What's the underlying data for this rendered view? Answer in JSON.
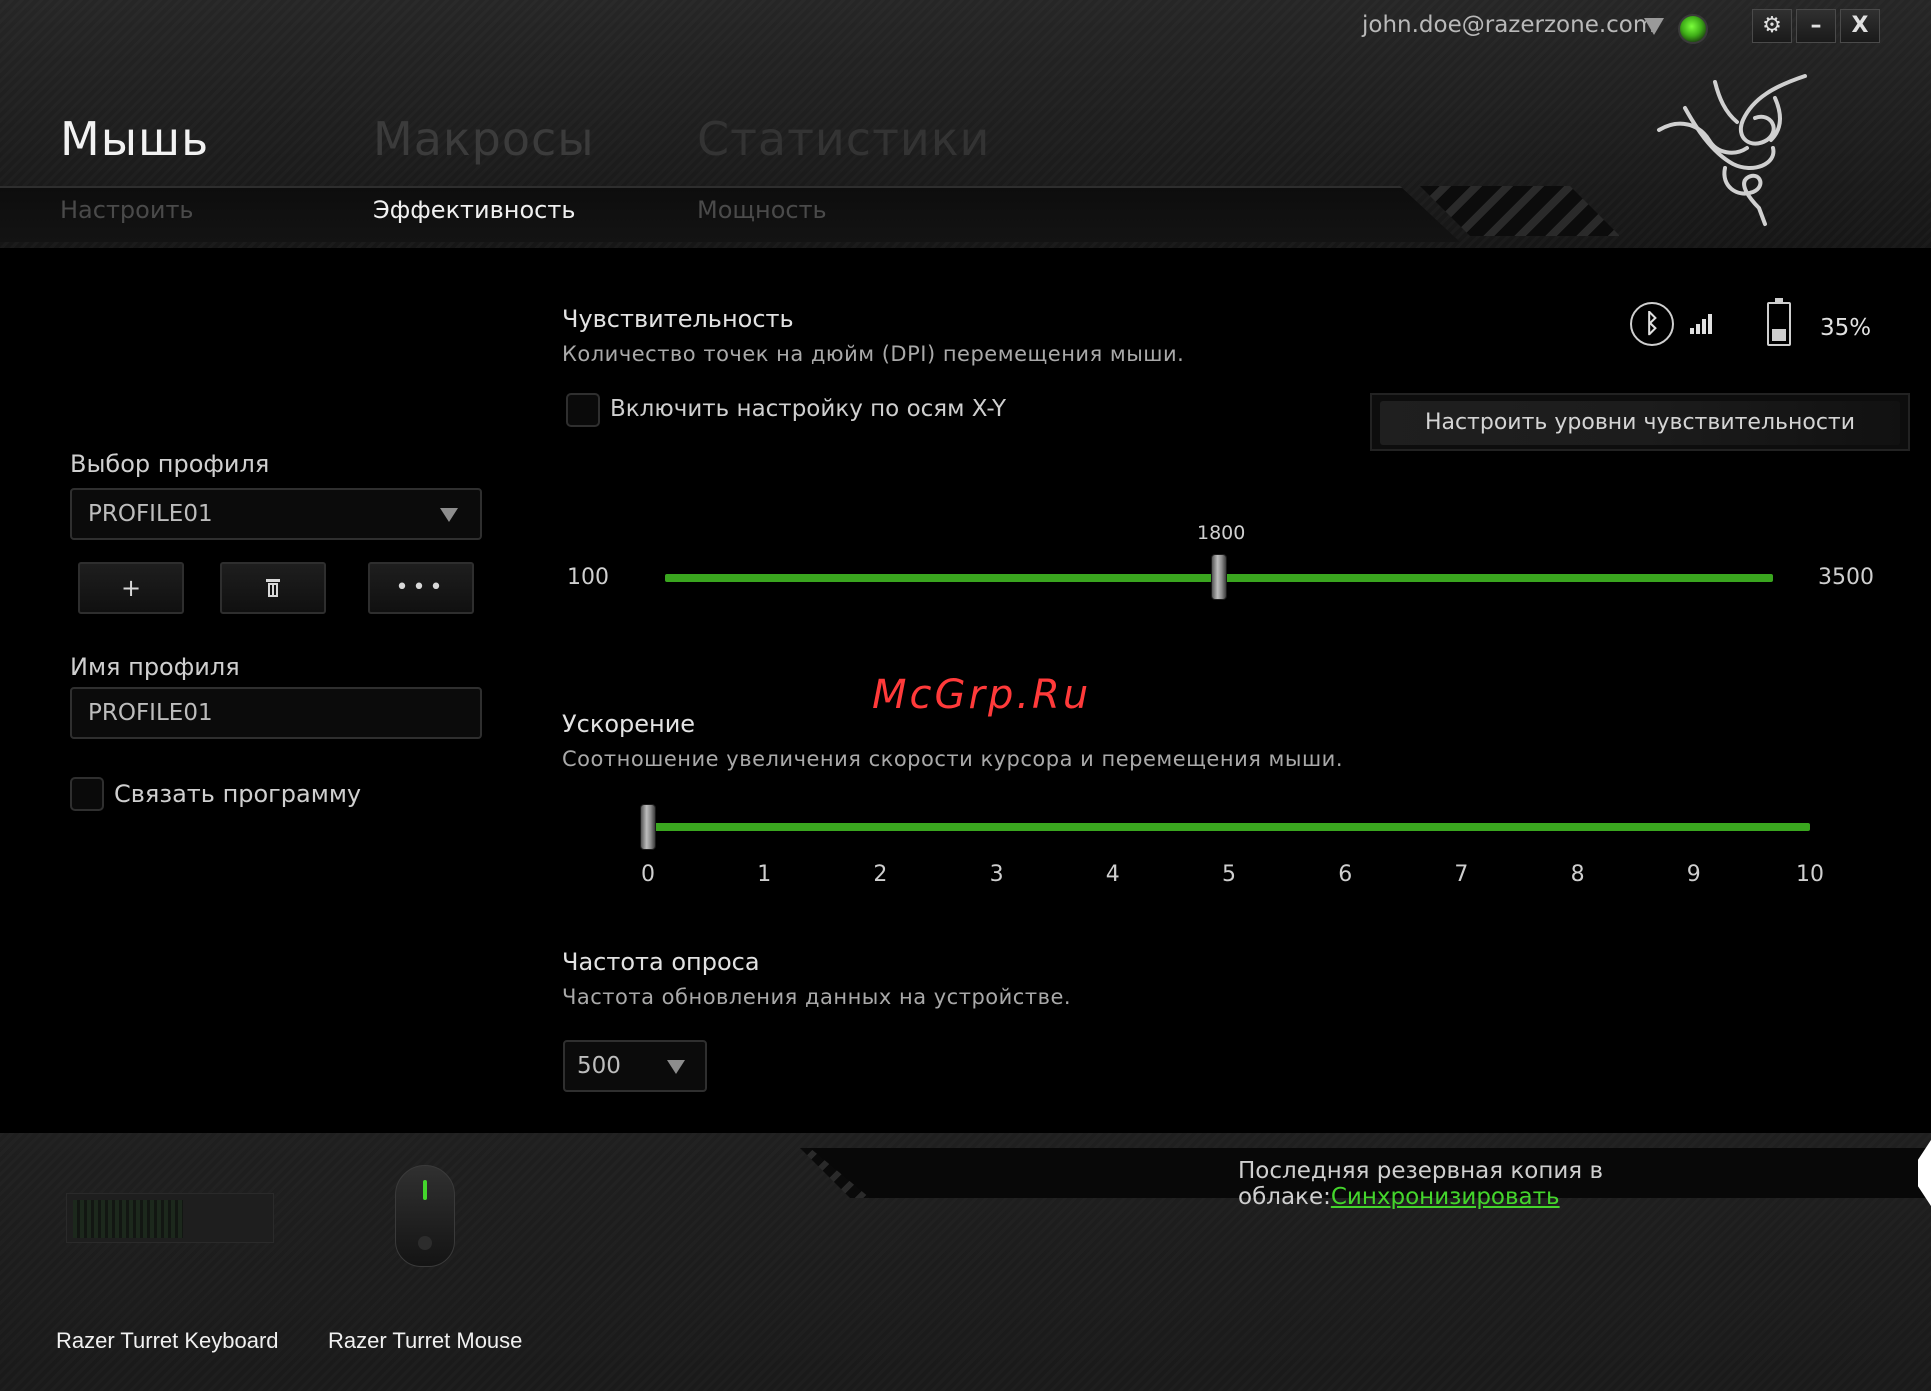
{
  "header": {
    "user_email": "john.doe@razerzone.com",
    "window_buttons": {
      "settings": "⚙",
      "minimize": "–",
      "close": "X"
    },
    "main_tabs": [
      "Мышь",
      "Макросы",
      "Статистики"
    ],
    "sub_tabs": [
      "Настроить",
      "Эффективность",
      "Мощность"
    ],
    "active_main_tab": "Мышь",
    "active_sub_tab": "Эффективность"
  },
  "profile": {
    "select_label": "Выбор профиля",
    "selected": "PROFILE01",
    "buttons": {
      "add": "+",
      "delete": "🗑",
      "more": "•••"
    },
    "name_label": "Имя профиля",
    "name_value": "PROFILE01",
    "link_program_label": "Связать программу",
    "link_program_checked": false
  },
  "status": {
    "bluetooth": "bluetooth-icon",
    "signal": "signal-icon",
    "battery_percent": "35%",
    "battery_level": 0.35
  },
  "sensitivity": {
    "title": "Чувствительность",
    "description": "Количество точек на дюйм (DPI) перемещения мыши.",
    "xy_label": "Включить настройку по осям X-Y",
    "xy_checked": false,
    "stages_button": "Настроить уровни чувствительности",
    "min": "100",
    "max": "3500",
    "value": "1800",
    "value_num": 1800,
    "min_num": 100,
    "max_num": 3500
  },
  "acceleration": {
    "title": "Ускорение",
    "description": "Соотношение увеличения скорости курсора и перемещения мыши.",
    "value": 0,
    "ticks": [
      "0",
      "1",
      "2",
      "3",
      "4",
      "5",
      "6",
      "7",
      "8",
      "9",
      "10"
    ]
  },
  "polling": {
    "title": "Частота опроса",
    "description": "Частота обновления данных на устройстве.",
    "value": "500"
  },
  "watermark": "McGrp.Ru",
  "footer": {
    "backup_text": "Последняя резервная копия в облаке:",
    "sync_link": "Синхронизировать",
    "devices": [
      "Razer Turret Keyboard",
      "Razer Turret Mouse"
    ]
  },
  "colors": {
    "accent": "#44d62c",
    "slider": "#3aa61f",
    "background": "#000000"
  }
}
